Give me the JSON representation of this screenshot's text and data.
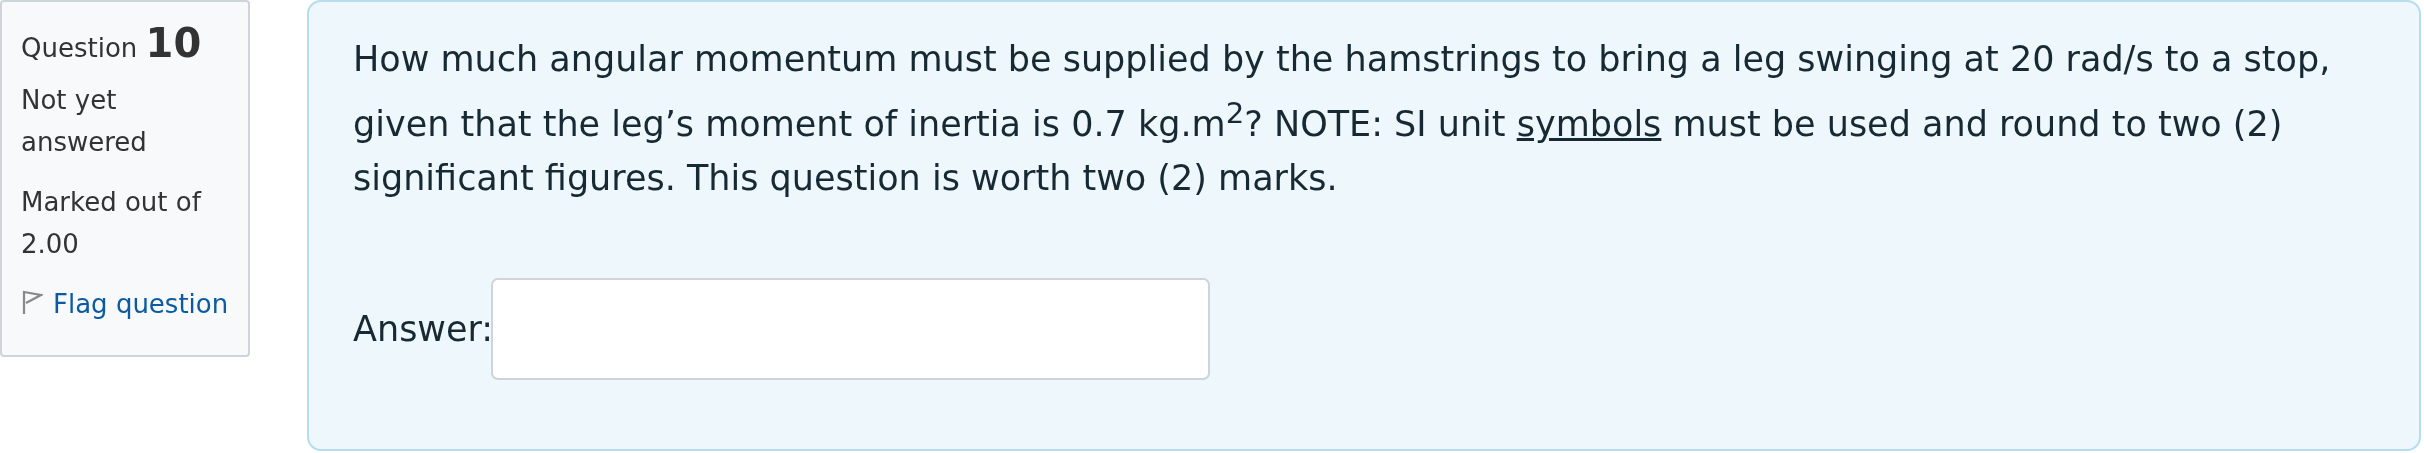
{
  "info": {
    "label": "Question",
    "number": "10",
    "status": "Not yet answered",
    "marks": "Marked out of 2.00",
    "flag": {
      "label": "Flag question",
      "flagged": false
    }
  },
  "question": {
    "text_before": "How much angular momentum must be supplied by the hamstrings to bring a leg swinging at 20 rad/s to a stop, given that the leg’s moment of inertia is 0.7 kg.m$^{2}$? NOTE: SI unit ",
    "link": "symbols",
    "text_after": " must be used and round to two (2) significant figures. This question is worth two (2) marks.",
    "answer_label": "Answer:"
  }
}
